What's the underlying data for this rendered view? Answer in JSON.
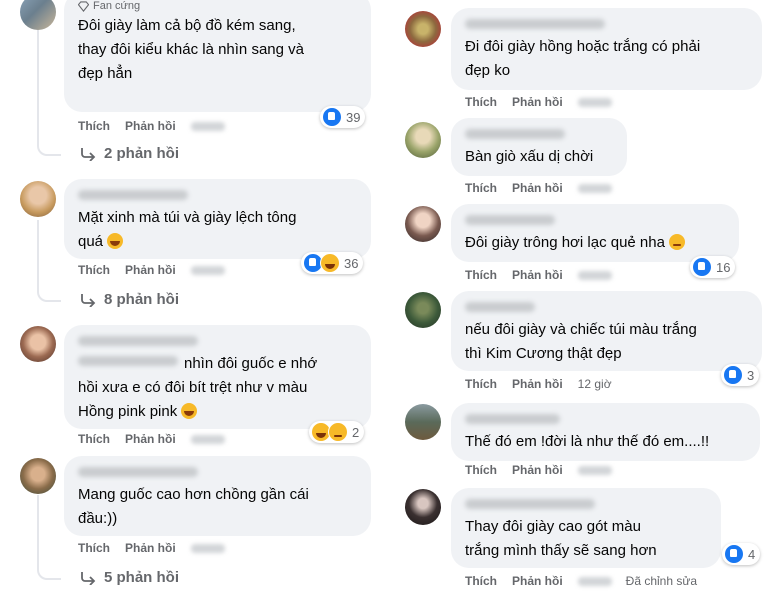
{
  "left": {
    "c1": {
      "badge": "Fan cứng",
      "text": "Đôi giày làm cả bộ đồ kém sang,\nthay đôi kiểu khác là nhìn sang và\nđẹp hẳn",
      "reactions": "39",
      "like": "Thích",
      "reply": "Phản hồi",
      "replies": "2 phản hồi"
    },
    "c2": {
      "text": "Mặt xinh mà túi và giày lệch tông\nquá",
      "reactions": "36",
      "like": "Thích",
      "reply": "Phản hồi",
      "replies": "8 phản hồi"
    },
    "c3": {
      "text_line1": "nhìn đôi guốc e nhớ",
      "text_rest": "hồi xưa e có đôi bít trệt như v màu\nHồng pink pink",
      "reactions": "2",
      "like": "Thích",
      "reply": "Phản hồi"
    },
    "c4": {
      "text": "Mang guốc cao hơn chồng gần cái\nđầu:))",
      "like": "Thích",
      "reply": "Phản hồi",
      "replies": "5 phản hồi"
    }
  },
  "right": {
    "r1": {
      "text": "Đi đôi giày hồng hoặc trắng có phải\nđẹp ko",
      "like": "Thích",
      "reply": "Phản hồi"
    },
    "r2": {
      "text": "Bàn giò xấu dị chời",
      "like": "Thích",
      "reply": "Phản hồi"
    },
    "r3": {
      "text": "Đôi giày trông hơi lạc quẻ nha",
      "reactions": "16",
      "like": "Thích",
      "reply": "Phản hồi"
    },
    "r4": {
      "text": "nếu đôi giày và chiếc túi màu trắng\nthì Kim Cương thật đẹp",
      "reactions": "3",
      "like": "Thích",
      "reply": "Phản hồi",
      "time": "12 giờ"
    },
    "r5": {
      "text": "Thế đó em !đời là như thế đó em....!!",
      "like": "Thích",
      "reply": "Phản hồi"
    },
    "r6": {
      "text": "Thay đôi giày cao gót màu\ntrắng mình thấy sẽ sang hơn",
      "reactions": "4",
      "like": "Thích",
      "reply": "Phản hồi",
      "edited": "Đã chỉnh sửa"
    }
  },
  "colors": {
    "bubble": "#f0f2f5",
    "secondary_text": "#65676b",
    "like_blue": "#1877f2",
    "emoji_yellow": "#f7b928"
  }
}
